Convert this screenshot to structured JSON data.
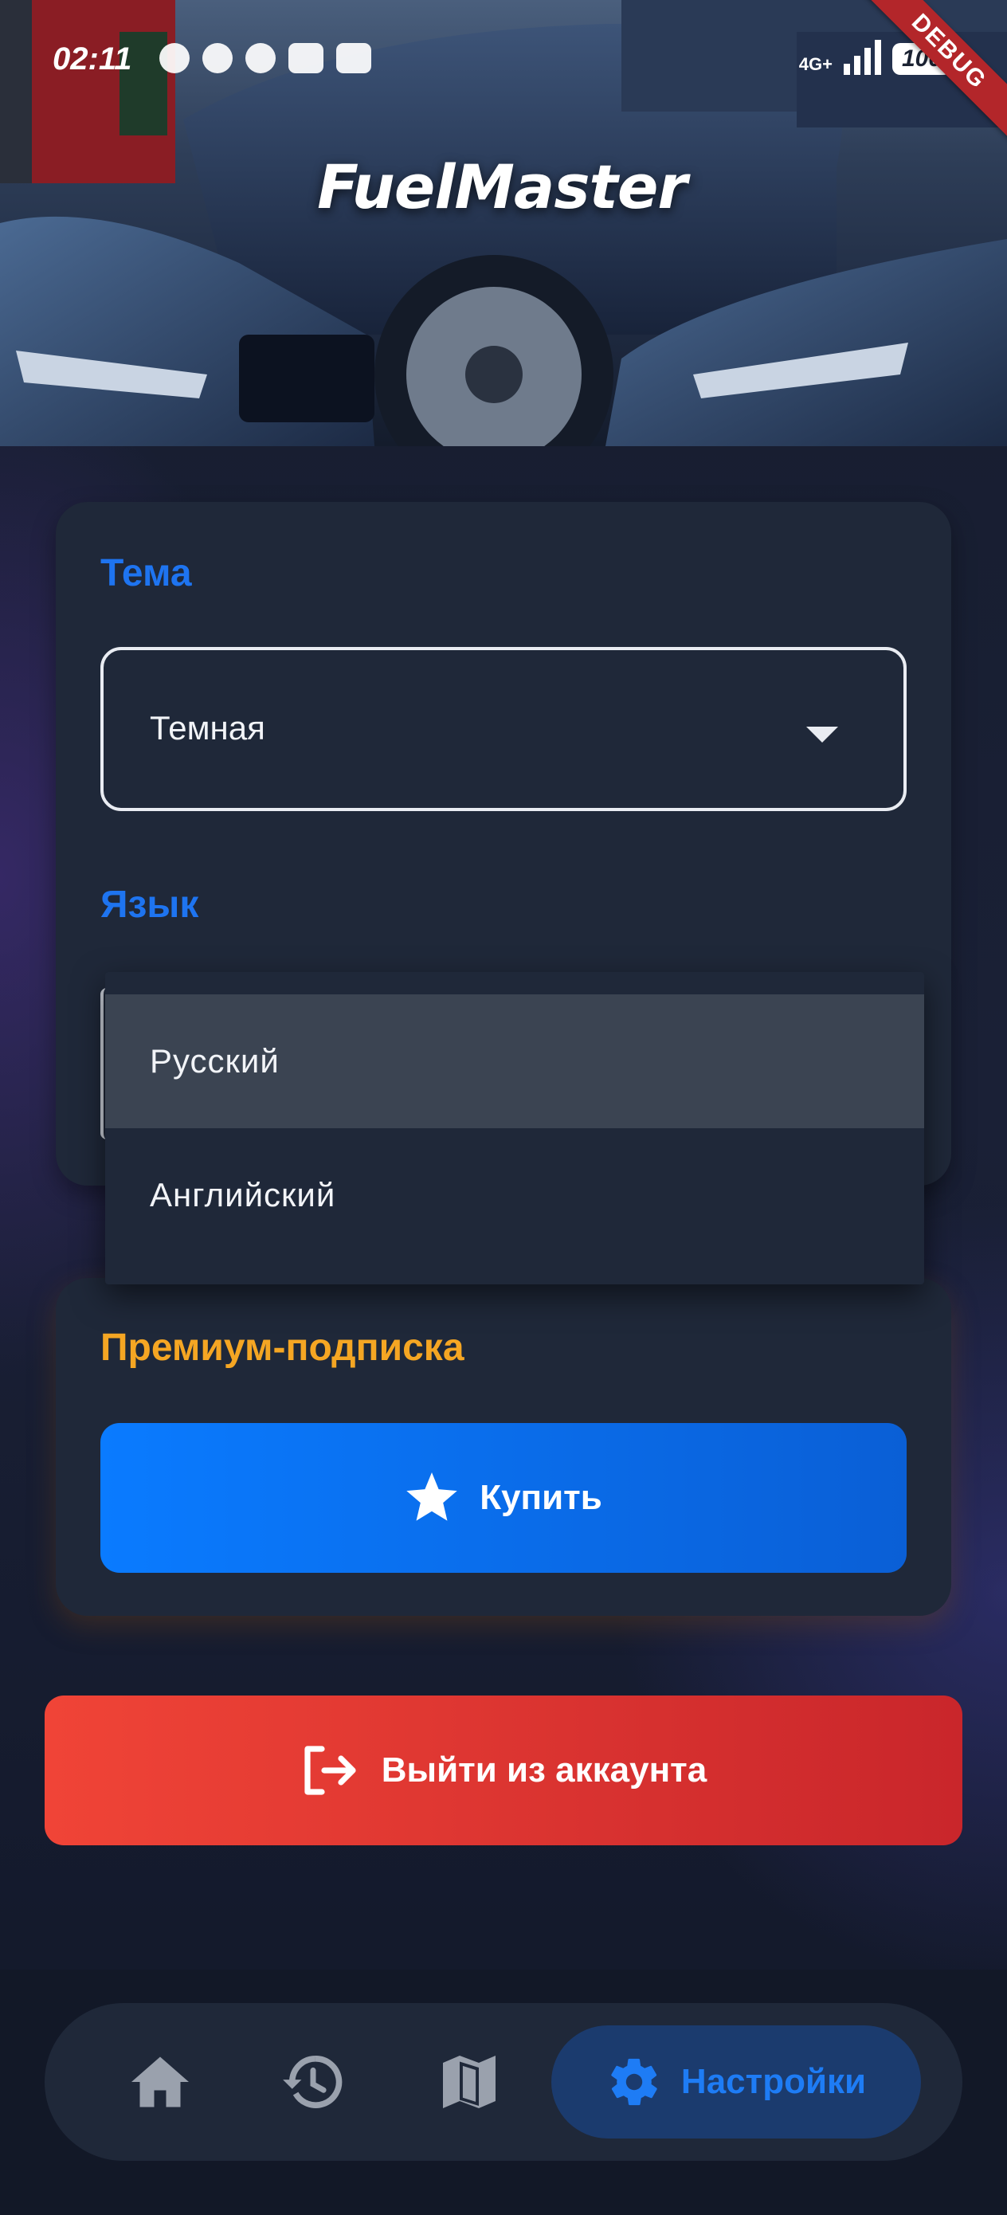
{
  "status_bar": {
    "time": "02:11",
    "network": "4G+",
    "battery": "100",
    "notification_icons": [
      "message-icon",
      "telegram-icon",
      "pinterest-icon",
      "youtube-icon",
      "cast-icon"
    ]
  },
  "debug_ribbon": "DEBUG",
  "header": {
    "brand": "FuelMaster"
  },
  "settings": {
    "theme": {
      "title": "Тема",
      "selected": "Темная"
    },
    "language": {
      "title": "Язык",
      "options": [
        {
          "label": "Русский",
          "selected": true
        },
        {
          "label": "Английский",
          "selected": false
        }
      ]
    }
  },
  "premium": {
    "title": "Премиум-подписка",
    "buy_label": "Купить",
    "buy_icon": "star-icon"
  },
  "logout": {
    "label": "Выйти из аккаунта",
    "icon": "logout-icon"
  },
  "bottom_nav": {
    "items": [
      {
        "icon": "home-icon",
        "label": ""
      },
      {
        "icon": "history-icon",
        "label": ""
      },
      {
        "icon": "map-icon",
        "label": ""
      },
      {
        "icon": "gear-icon",
        "label": "Настройки",
        "active": true
      }
    ]
  },
  "colors": {
    "accent_blue": "#1e74f0",
    "premium_amber": "#f5a623",
    "logout_red": "#e23b33",
    "card_bg": "#1f2839"
  }
}
